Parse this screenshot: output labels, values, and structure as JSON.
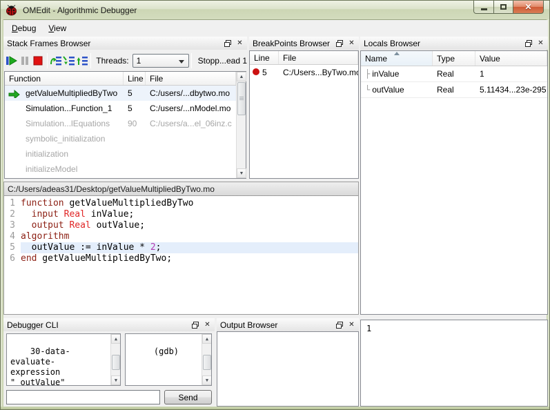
{
  "window": {
    "title": "OMEdit - Algorithmic Debugger"
  },
  "icons": {
    "close_glyph": "✕",
    "app_icon": "ladybug-icon",
    "dock_float": "float-icon",
    "dock_close": "close-icon"
  },
  "menu": {
    "items": [
      {
        "label": "Debug"
      },
      {
        "label": "View"
      }
    ]
  },
  "stack_frames": {
    "title": "Stack Frames Browser",
    "toolbar": {
      "threads_label": "Threads:",
      "threads_value": "1",
      "status": "Stopp...ead 1",
      "buttons": [
        "resume-icon",
        "pause-icon",
        "stop-icon",
        "step-over-icon",
        "step-into-icon",
        "step-return-icon"
      ]
    },
    "columns": [
      "Function",
      "Line",
      "File"
    ],
    "rows": [
      {
        "function": "getValueMultipliedByTwo",
        "line": "5",
        "file": "C:/users/...dbytwo.mo",
        "current": true,
        "inactive": false
      },
      {
        "function": "Simulation...Function_1",
        "line": "5",
        "file": "C:/users/...nModel.mo",
        "current": false,
        "inactive": false
      },
      {
        "function": "Simulation...lEquations",
        "line": "90",
        "file": "C:/users/a...el_06inz.c",
        "current": false,
        "inactive": true
      },
      {
        "function": "symbolic_initialization",
        "line": "",
        "file": "",
        "current": false,
        "inactive": true
      },
      {
        "function": "initialization",
        "line": "",
        "file": "",
        "current": false,
        "inactive": true
      },
      {
        "function": "initializeModel",
        "line": "",
        "file": "",
        "current": false,
        "inactive": true
      }
    ]
  },
  "breakpoints": {
    "title": "BreakPoints Browser",
    "columns": [
      "Line",
      "File"
    ],
    "rows": [
      {
        "line": "5",
        "file": "C:/Users...ByTwo.mo"
      }
    ]
  },
  "locals": {
    "title": "Locals Browser",
    "columns": [
      "Name",
      "Type",
      "Value"
    ],
    "rows": [
      {
        "tree": "├",
        "name": "inValue",
        "type": "Real",
        "value": "1"
      },
      {
        "tree": "└",
        "name": "outValue",
        "type": "Real",
        "value": "5.11434...23e-295"
      }
    ],
    "value_preview": "1"
  },
  "editor": {
    "path": "C:/Users/adeas31/Desktop/getValueMultipliedByTwo.mo",
    "lines": [
      {
        "n": "1",
        "hl": false,
        "segs": [
          {
            "c": "k",
            "t": "function"
          },
          {
            "c": "p",
            "t": " getValueMultipliedByTwo"
          }
        ]
      },
      {
        "n": "2",
        "hl": false,
        "segs": [
          {
            "c": "p",
            "t": "  "
          },
          {
            "c": "k",
            "t": "input"
          },
          {
            "c": "p",
            "t": " "
          },
          {
            "c": "t",
            "t": "Real"
          },
          {
            "c": "p",
            "t": " inValue;"
          }
        ]
      },
      {
        "n": "3",
        "hl": false,
        "segs": [
          {
            "c": "p",
            "t": "  "
          },
          {
            "c": "k",
            "t": "output"
          },
          {
            "c": "p",
            "t": " "
          },
          {
            "c": "t",
            "t": "Real"
          },
          {
            "c": "p",
            "t": " outValue;"
          }
        ]
      },
      {
        "n": "4",
        "hl": false,
        "segs": [
          {
            "c": "k",
            "t": "algorithm"
          }
        ]
      },
      {
        "n": "5",
        "hl": true,
        "segs": [
          {
            "c": "p",
            "t": "  outValue := inValue * "
          },
          {
            "c": "n",
            "t": "2"
          },
          {
            "c": "p",
            "t": ";"
          }
        ]
      },
      {
        "n": "6",
        "hl": false,
        "segs": [
          {
            "c": "k",
            "t": "end"
          },
          {
            "c": "p",
            "t": " getValueMultipliedByTwo;"
          }
        ]
      }
    ]
  },
  "debugger_cli": {
    "title": "Debugger CLI",
    "command_log": "30-data-evaluate-\nexpression\n\"_outValue\"",
    "response": "(gdb)",
    "input_value": "",
    "send_label": "Send"
  },
  "output_browser": {
    "title": "Output Browser",
    "content": ""
  }
}
